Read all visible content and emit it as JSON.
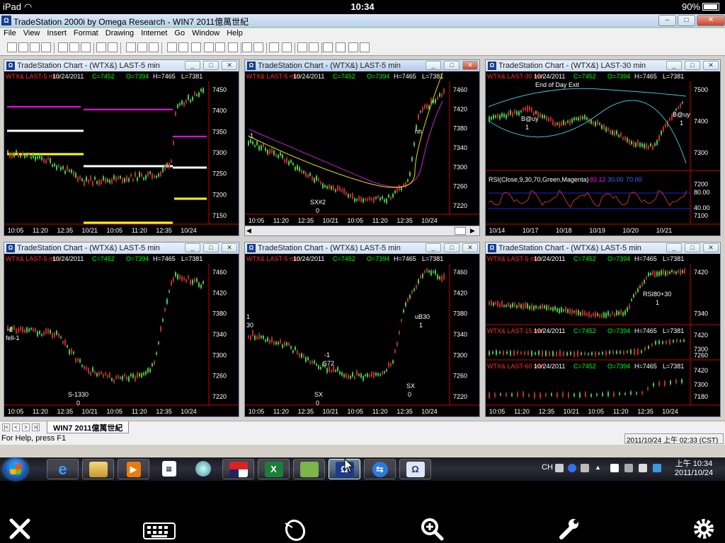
{
  "ios": {
    "carrier": "iPad",
    "time": "10:34",
    "battery": "90%"
  },
  "app": {
    "title": "TradeStation 2000i by Omega Research - WIN7 2011億萬世紀",
    "menu": [
      "File",
      "View",
      "Insert",
      "Format",
      "Drawing",
      "Internet",
      "Go",
      "Window",
      "Help"
    ]
  },
  "panes": [
    {
      "title": "TradeStation Chart - (WTX&)  LAST-5 min",
      "sym": "WTX& LAST-5 min",
      "date": "10/24/2011",
      "c": "C=7452",
      "o": "O=7394",
      "h": "H=7465",
      "l": "L=7381",
      "xt": [
        "10:05",
        "11:20",
        "12:35",
        "10/21",
        "10:05",
        "11:20",
        "12:35",
        "10/24"
      ],
      "yt": [
        "7450",
        "7400",
        "7350",
        "7300",
        "7250",
        "7200",
        "7150"
      ],
      "marks": []
    },
    {
      "title": "TradeStation Chart - (WTX&)  LAST-5 min",
      "sym": "WTX& LAST-5 min",
      "date": "10/24/2011",
      "c": "C=7452",
      "o": "O=7394",
      "h": "H=7465",
      "l": "L=7381",
      "xt": [
        "10:05",
        "11:20",
        "12:35",
        "10/21",
        "10:05",
        "11:20",
        "12:35",
        "10/24"
      ],
      "yt": [
        "7460",
        "7420",
        "7380",
        "7340",
        "7300",
        "7260",
        "7220"
      ],
      "marks": [
        "-1",
        "SX#2",
        "0",
        "hh"
      ]
    },
    {
      "title": "TradeStation Chart - (WTX&)  LAST-30 min",
      "sym": "WTX& LAST-30 min",
      "date": "10/24/2011",
      "c": "C=7452",
      "o": "O=7394",
      "h": "H=7465",
      "l": "L=7381",
      "xt": [
        "10/14",
        "10/17",
        "10/18",
        "10/19",
        "10/20",
        "10/21"
      ],
      "yt": [
        "7500",
        "7400",
        "7300",
        "7200",
        "7100"
      ],
      "marks": [
        "End of Day Exit",
        "B@uy",
        "1",
        "B@uy",
        "1"
      ],
      "rsi": {
        "label": "RSI(Close,9,30,70,Green,Magenta)",
        "v1": "83.12",
        "v2": "30.00",
        "v3": "70.00",
        "yt": [
          "80.00",
          "40.00"
        ]
      }
    },
    {
      "title": "TradeStation Chart - (WTX&)  LAST-5 min",
      "sym": "WTX& LAST-5 min",
      "date": "10/24/2011",
      "c": "C=7452",
      "o": "O=7394",
      "h": "H=7465",
      "l": "L=7381",
      "xt": [
        "10:05",
        "11:20",
        "12:35",
        "10/21",
        "10:05",
        "11:20",
        "12:35",
        "10/24"
      ],
      "yt": [
        "7460",
        "7420",
        "7380",
        "7340",
        "7300",
        "7260",
        "7220"
      ],
      "marks": [
        "-1",
        "fell-1",
        "S-1330",
        "0"
      ]
    },
    {
      "title": "TradeStation Chart - (WTX&)  LAST-5 min",
      "sym": "WTX& LAST-5 min",
      "date": "10/24/2011",
      "c": "C=7452",
      "o": "O=7394",
      "h": "H=7465",
      "l": "L=7381",
      "xt": [
        "10:05",
        "11:20",
        "12:35",
        "10/21",
        "10:05",
        "11:20",
        "12:35",
        "10/24"
      ],
      "yt": [
        "7460",
        "7420",
        "7380",
        "7340",
        "7300",
        "7260",
        "7220"
      ],
      "marks": [
        "1",
        "30",
        "-1",
        "S72",
        "SX",
        "0",
        "uB30",
        "1",
        "SX",
        "0"
      ]
    },
    {
      "title": "TradeStation Chart - (WTX&)  LAST-5 min",
      "sym": "WTX& LAST-5 min",
      "date": "10/24/2011",
      "c": "C=7452",
      "o": "O=7394",
      "h": "H=7465",
      "l": "L=7381",
      "xt": [
        "10:05",
        "11:20",
        "12:35",
        "10/21",
        "10:05",
        "11:20",
        "12:35",
        "10/24"
      ],
      "yt": [
        "7420",
        "7340",
        "7260",
        "7180"
      ],
      "marks": [
        "RSI80+30",
        "1"
      ],
      "sub": [
        {
          "sym": "WTX& LAST-15 min",
          "date": "10/24/2011",
          "c": "C=7452",
          "o": "O=7394",
          "h": "H=7465",
          "l": "L=7381",
          "yt": [
            "7420",
            "7300"
          ]
        },
        {
          "sym": "WTX& LAST-60 min",
          "date": "10/24/2011",
          "c": "C=7452",
          "o": "O=7394",
          "h": "H=7465",
          "l": "L=7381",
          "yt": [
            "7420",
            "7300"
          ]
        }
      ]
    }
  ],
  "tab": {
    "label": "WIN7 2011億萬世紀"
  },
  "status": {
    "help": "For Help, press F1",
    "time": "2011/10/24 上午 02:33 (CST)"
  },
  "tray": {
    "lang": "CH",
    "time": "上午 10:34",
    "date": "2011/10/24"
  },
  "colors": {
    "up": "#3cd23c",
    "down": "#e02020",
    "price_axis": "#ffffff",
    "sym": "#ff3030",
    "close": "#00ff00"
  }
}
